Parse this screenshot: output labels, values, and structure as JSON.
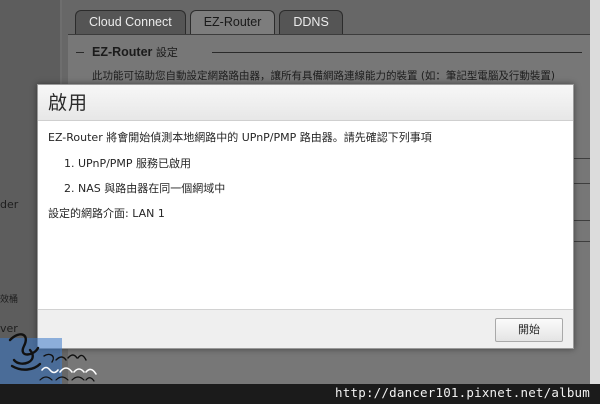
{
  "tabs": [
    {
      "label": "Cloud Connect"
    },
    {
      "label": "EZ-Router"
    },
    {
      "label": "DDNS"
    }
  ],
  "background": {
    "section_title": "EZ-Router",
    "section_title_suffix": "設定",
    "description": "此功能可協助您自動設定網路路由器，讓所有具備網路連線能力的裝置 (如：筆記型電腦及行動裝置)",
    "left_fragments": [
      "der",
      "效桶",
      "ver"
    ]
  },
  "modal": {
    "title": "啟用",
    "intro": "EZ-Router 將會開始偵測本地網路中的 UPnP/PMP 路由器。請先確認下列事項",
    "items": [
      "1. UPnP/PMP 服務已啟用",
      "2. NAS 與路由器在同一個網域中"
    ],
    "interface_label": "設定的網路介面: LAN 1",
    "start_button": "開始"
  },
  "watermark": {
    "handwriting": "dancer101"
  },
  "url_bar": {
    "text": "http://dancer101.pixnet.net/album"
  }
}
